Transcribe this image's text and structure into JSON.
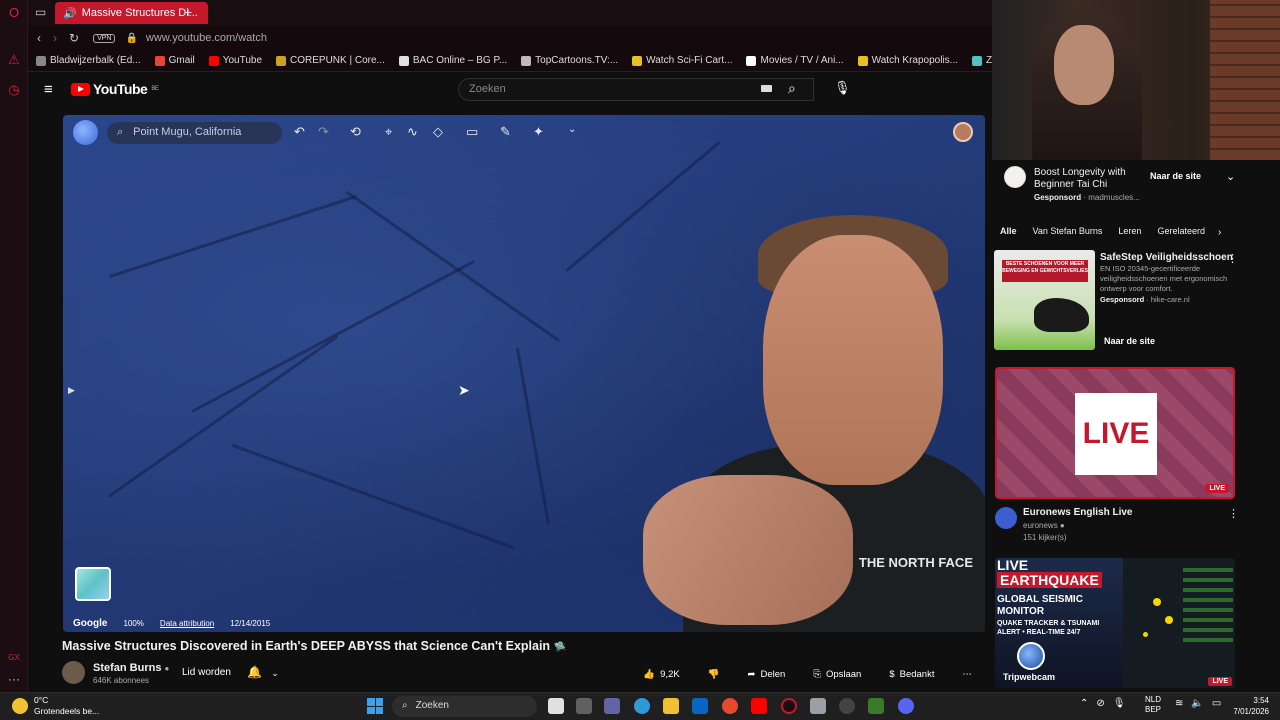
{
  "browser": {
    "tab_title": "Massive Structures Di...",
    "url": "www.youtube.com/watch",
    "vpn_label": "VPN",
    "bookmarks": [
      {
        "label": "Bladwijzerbalk (Ed...",
        "color": "#888888"
      },
      {
        "label": "Gmail",
        "color": "#ea4335"
      },
      {
        "label": "YouTube",
        "color": "#ff0000"
      },
      {
        "label": "COREPUNK | Core...",
        "color": "#d0a020"
      },
      {
        "label": "BAC Online – BG P...",
        "color": "#e0e0e0"
      },
      {
        "label": "TopCartoons.TV:...",
        "color": "#bbbbbb"
      },
      {
        "label": "Watch Sci-Fi Cart...",
        "color": "#e8c020"
      },
      {
        "label": "Movies / TV / Ani...",
        "color": "#ffffff"
      },
      {
        "label": "Watch Krapopolis...",
        "color": "#e8c020"
      },
      {
        "label": "Zamnesia | Het Be...",
        "color": "#4fc3c0"
      }
    ]
  },
  "youtube": {
    "logo_text": "YouTube",
    "region": "BE",
    "search_placeholder": "Zoeken"
  },
  "earth_ui": {
    "search_text": "Point Mugu, California",
    "footer": {
      "brand": "Google",
      "zoom": "100%",
      "attribution": "Data attribution",
      "date": "12/14/2015"
    }
  },
  "video": {
    "title": "Massive Structures Discovered in Earth's DEEP ABYSS that Science Can't Explain",
    "channel": "Stefan Burns",
    "subscribers": "646K abonnees",
    "join_label": "Lid worden",
    "jacket_brand": "THE NORTH FACE",
    "actions": {
      "likes": "9,2K",
      "share": "Delen",
      "save": "Opslaan",
      "thanks": "Bedankt"
    }
  },
  "sidebar": {
    "ad1": {
      "title": "Boost Longevity with Beginner Tai Chi",
      "sponsored": "Gesponsord",
      "advertiser": "· madmuscles...",
      "cta": "Naar de site"
    },
    "chips": [
      "Alle",
      "Van Stefan Burns",
      "Leren",
      "Gerelateerd"
    ],
    "ad2": {
      "banner": "BESTE SCHOENEN VOOR MEER BEWEGING EN GEWICHTSVERLIES",
      "title": "SafeStep Veiligheidsschoen",
      "description": "EN ISO 20345-gecertificeerde veiligheidsschoenen met ergonomisch ontwerp voor comfort.",
      "sponsored": "Gesponsord",
      "advertiser": "· hike-care.nl",
      "cta": "Naar de site"
    },
    "live_video": {
      "thumb_text": "LIVE",
      "badge": "LIVE",
      "title": "Euronews English Live",
      "channel": "euronews",
      "viewers": "151 kijker(s)"
    },
    "quake_video": {
      "line1": "LIVE",
      "line2": "EARTHQUAKE",
      "line3": "GLOBAL SEISMIC",
      "line4": "MONITOR",
      "line5": "QUAKE TRACKER & TSUNAMI",
      "line6": "ALERT • REAL-TIME 24/7",
      "brand": "Tripwebcam",
      "badge": "LIVE"
    }
  },
  "taskbar": {
    "temperature": "0°C",
    "weather": "Grotendeels be...",
    "search": "Zoeken",
    "lang1": "NLD",
    "lang2": "BEP",
    "time": "3:54",
    "date": "7/01/2026"
  },
  "colors": {
    "accent": "#c4192c",
    "youtube_red": "#ff0000",
    "bg": "#0f0f0f"
  }
}
